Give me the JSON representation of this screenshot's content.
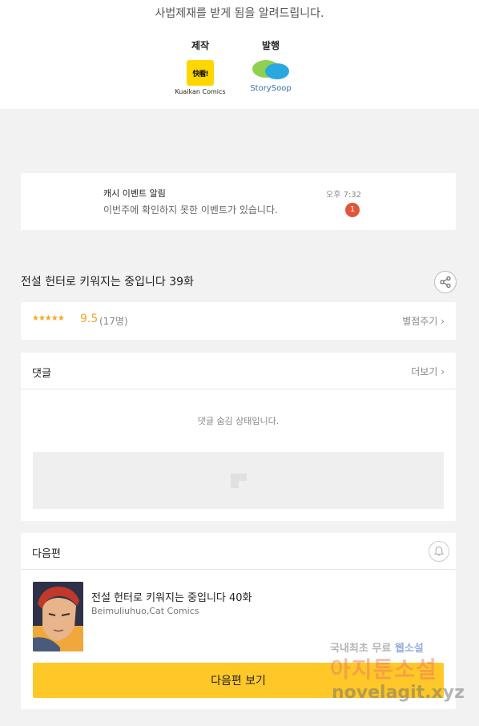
{
  "top": {
    "notice": "사법제재를 받게 됨을 알려드립니다.",
    "credits": [
      {
        "label": "제작",
        "logo_text": "快看!",
        "caption": "Kuaikan Comics"
      },
      {
        "label": "발행",
        "caption": "StorySoop"
      }
    ]
  },
  "notification": {
    "title": "캐시 이벤트 알림",
    "text": "이번주에 확인하지 못한 이벤트가 있습니다.",
    "time": "오후 7:32",
    "badge": "1"
  },
  "episode": {
    "title": "전설 헌터로 키워지는 중입니다 39화",
    "share_icon": "share-icon"
  },
  "rating": {
    "stars": "★★★★★",
    "score": "9.5",
    "count": "(17명)",
    "rate_link": "별점주기 ›"
  },
  "comments": {
    "title": "댓글",
    "more": "더보기 ›",
    "hidden_msg": "댓글 숨김 상태입니다."
  },
  "next": {
    "section_title": "다음편",
    "bell_icon": "bell-icon",
    "episode_title": "전설 헌터로 키워지는 중입니다 40화",
    "author": "Beimuliuhuo,Cat Comics",
    "button": "다음편 보기"
  },
  "watermark": {
    "line1_a": "국내최초 무료 ",
    "line1_b": "웹소설",
    "line2": "아지툰소설",
    "line3": "novelagit.xyz"
  }
}
